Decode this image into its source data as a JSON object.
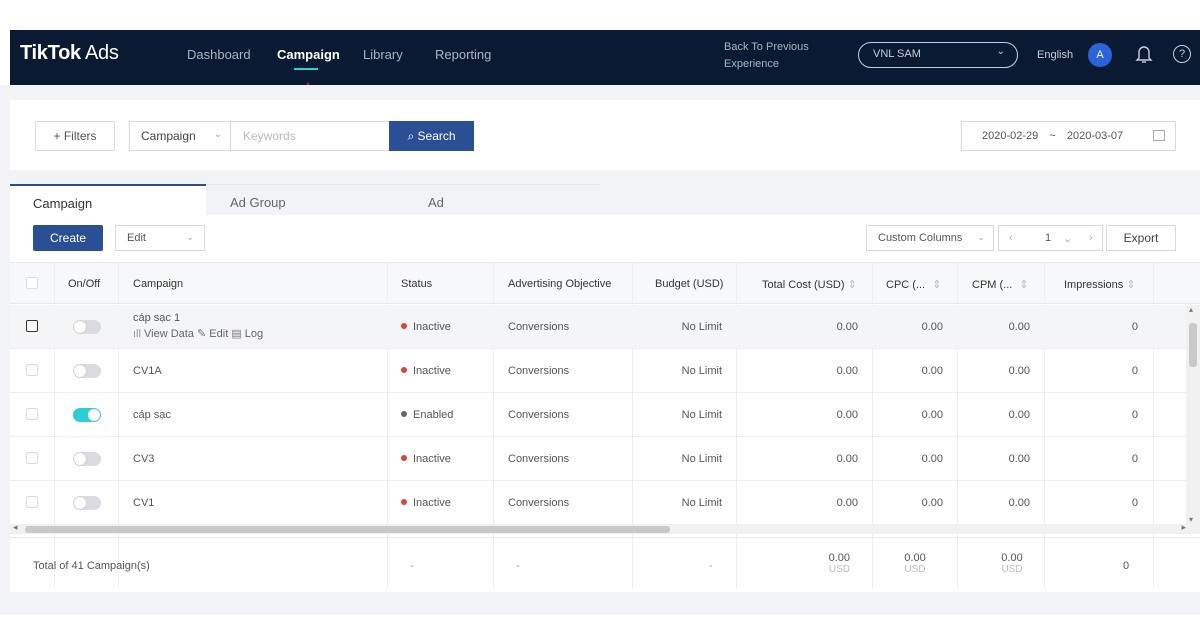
{
  "header": {
    "logo_bold": "TikTok",
    "logo_light": " Ads",
    "nav": [
      "Dashboard",
      "Campaign",
      "Library",
      "Reporting"
    ],
    "back_line1": "Back To Previous",
    "back_line2": "Experience",
    "account": "VNL SAM",
    "language": "English",
    "avatar": "A",
    "help": "?"
  },
  "filters": {
    "filters_label": "+ Filters",
    "scope": "Campaign",
    "keyword_placeholder": "Keywords",
    "search_label": "Search",
    "date_start": "2020-02-29",
    "date_sep": "~",
    "date_end": "2020-03-07"
  },
  "tabs": [
    "Campaign",
    "Ad Group",
    "Ad"
  ],
  "toolbar": {
    "create": "Create",
    "edit": "Edit",
    "custom_columns": "Custom Columns",
    "page": "1",
    "export": "Export"
  },
  "columns": [
    "On/Off",
    "Campaign",
    "Status",
    "Advertising Objective",
    "Budget (USD)",
    "Total Cost (USD)",
    "CPC (...",
    "CPM (...",
    "Impressions"
  ],
  "row_actions": {
    "view": "View Data",
    "edit": "Edit",
    "log": "Log"
  },
  "rows": [
    {
      "name": "cáp sạc 1",
      "on": false,
      "status": "Inactive",
      "objective": "Conversions",
      "budget": "No Limit",
      "cost": "0.00",
      "cpc": "0.00",
      "cpm": "0.00",
      "impressions": "0"
    },
    {
      "name": "CV1A",
      "on": false,
      "status": "Inactive",
      "objective": "Conversions",
      "budget": "No Limit",
      "cost": "0.00",
      "cpc": "0.00",
      "cpm": "0.00",
      "impressions": "0"
    },
    {
      "name": "cáp sạc",
      "on": true,
      "status": "Enabled",
      "objective": "Conversions",
      "budget": "No Limit",
      "cost": "0.00",
      "cpc": "0.00",
      "cpm": "0.00",
      "impressions": "0"
    },
    {
      "name": "CV3",
      "on": false,
      "status": "Inactive",
      "objective": "Conversions",
      "budget": "No Limit",
      "cost": "0.00",
      "cpc": "0.00",
      "cpm": "0.00",
      "impressions": "0"
    },
    {
      "name": "CV1",
      "on": false,
      "status": "Inactive",
      "objective": "Conversions",
      "budget": "No Limit",
      "cost": "0.00",
      "cpc": "0.00",
      "cpm": "0.00",
      "impressions": "0"
    }
  ],
  "footer": {
    "total": "Total of 41 Campaign(s)",
    "dash": "-",
    "cost": "0.00",
    "cpc": "0.00",
    "cpm": "0.00",
    "currency": "USD",
    "impressions": "0"
  },
  "colors": {
    "navy": "#0b1a33",
    "primary": "#2b4f94",
    "accent": "#2bcfd3",
    "inactive": "#e0423c",
    "enabled": "#666666",
    "arrow": "#c0202a"
  }
}
